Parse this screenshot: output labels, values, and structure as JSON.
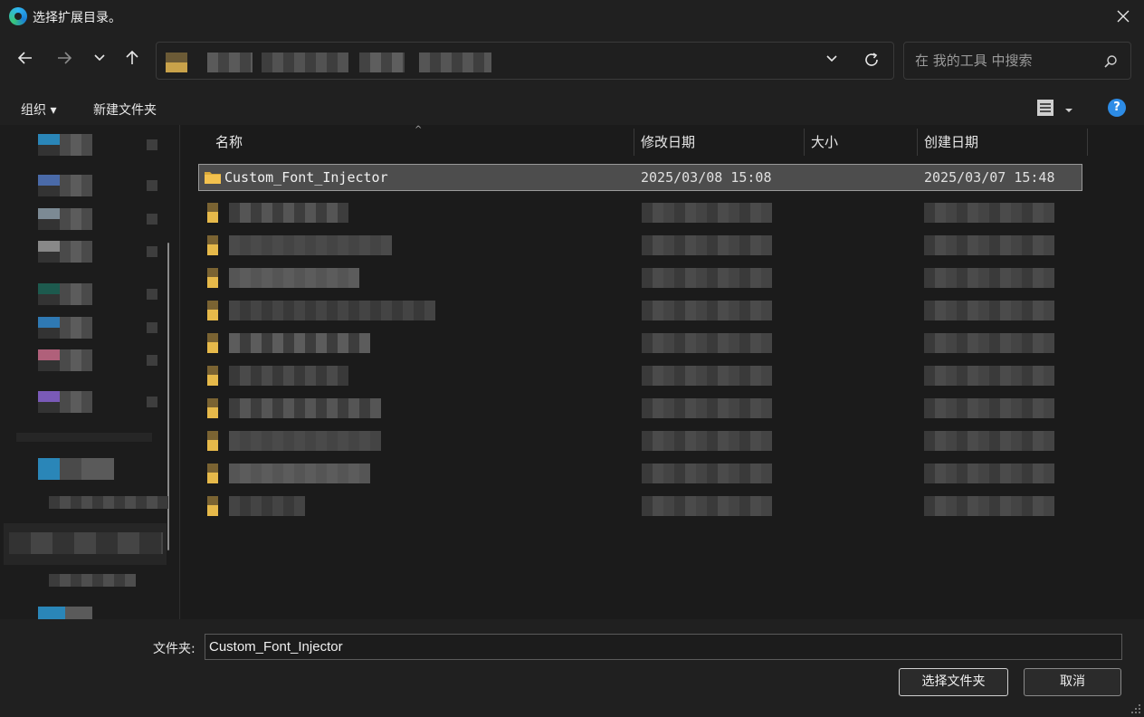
{
  "window": {
    "title": "选择扩展目录。"
  },
  "search": {
    "placeholder": "在 我的工具 中搜索"
  },
  "commands": {
    "organize": "组织 ▾",
    "new_folder": "新建文件夹",
    "help": "?"
  },
  "columns": {
    "name": "名称",
    "modified": "修改日期",
    "size": "大小",
    "created": "创建日期"
  },
  "selected_item": {
    "name": "Custom_Font_Injector",
    "modified": "2025/03/08 15:08",
    "created": "2025/03/07 15:48"
  },
  "footer": {
    "folder_label": "文件夹:",
    "folder_value": "Custom_Font_Injector",
    "select_button": "选择文件夹",
    "cancel_button": "取消"
  },
  "colors": {
    "accent": "#2d8ce6",
    "folder": "#f2c14e",
    "background": "#1b1b1b"
  }
}
